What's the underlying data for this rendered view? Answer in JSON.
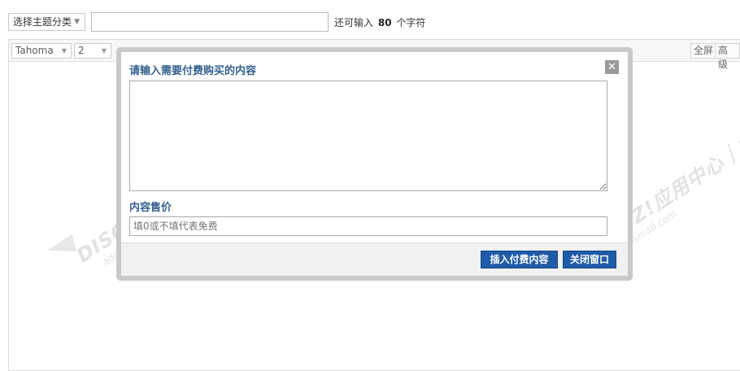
{
  "header": {
    "topic_select": "选择主题分类",
    "subject_value": "",
    "counter_prefix": "还可输入",
    "counter_value": "80",
    "counter_suffix": "个字符"
  },
  "toolbar": {
    "font_family": "Tahoma",
    "font_size": "2",
    "icons": [
      "bold-icon",
      "italic-icon",
      "underline-icon",
      "font-color-icon",
      "background-color-icon",
      "link-icon",
      "align-left-icon",
      "align-center-icon",
      "align-right-icon",
      "align-justify-icon",
      "smiley-icon",
      "image-icon",
      "attachment-icon",
      "media-icon",
      "quote-icon",
      "code-icon",
      "pay-content-icon"
    ],
    "fullscreen_label": "全屏",
    "advanced_label": "高级"
  },
  "dialog": {
    "title": "请输入需要付费购买的内容",
    "content_value": "",
    "price_label": "内容售价",
    "price_placeholder": "填0或不填代表免费",
    "insert_label": "插入付费内容",
    "close_label": "关闭窗口"
  },
  "watermark": {
    "brand": "DISCUZ!应用中心｜贰道",
    "url": "addon.dismall.com"
  }
}
